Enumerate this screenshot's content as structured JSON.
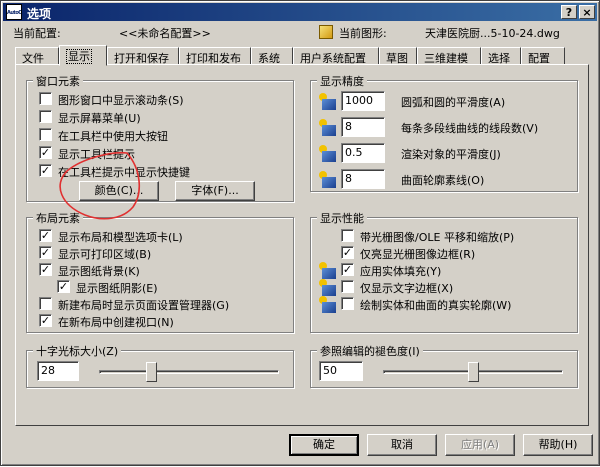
{
  "window": {
    "title": "选项",
    "app_icon": "AutoCAD",
    "help_label": "?",
    "close_label": "×"
  },
  "info": {
    "current_profile_label": "当前配置:",
    "current_profile_value": "<<未命名配置>>",
    "current_drawing_label": "当前图形:",
    "current_drawing_value": "天津医院厨...5-10-24.dwg"
  },
  "tabs": [
    "文件",
    "显示",
    "打开和保存",
    "打印和发布",
    "系统",
    "用户系统配置",
    "草图",
    "三维建模",
    "选择",
    "配置"
  ],
  "active_tab": "显示",
  "window_elements": {
    "title": "窗口元素",
    "items": [
      {
        "label": "图形窗口中显示滚动条(S)",
        "checked": false
      },
      {
        "label": "显示屏幕菜单(U)",
        "checked": false
      },
      {
        "label": "在工具栏中使用大按钮",
        "checked": false
      },
      {
        "label": "显示工具栏提示",
        "checked": true
      },
      {
        "label": "在工具栏提示中显示快捷键",
        "checked": true
      }
    ],
    "colors_button": "颜色(C)...",
    "fonts_button": "字体(F)..."
  },
  "layout_elements": {
    "title": "布局元素",
    "items": [
      {
        "label": "显示布局和模型选项卡(L)",
        "checked": true
      },
      {
        "label": "显示可打印区域(B)",
        "checked": true
      },
      {
        "label": "显示图纸背景(K)",
        "checked": true
      },
      {
        "label": "显示图纸阴影(E)",
        "checked": true
      },
      {
        "label": "新建布局时显示页面设置管理器(G)",
        "checked": false
      },
      {
        "label": "在新布局中创建视口(N)",
        "checked": true
      }
    ]
  },
  "crosshair": {
    "title": "十字光标大小(Z)",
    "value": "28",
    "level_percent": 28
  },
  "display_resolution": {
    "title": "显示精度",
    "items": [
      {
        "value": "1000",
        "label": "圆弧和圆的平滑度(A)"
      },
      {
        "value": "8",
        "label": "每条多段线曲线的线段数(V)"
      },
      {
        "value": "0.5",
        "label": "渲染对象的平滑度(J)"
      },
      {
        "value": "8",
        "label": "曲面轮廓素线(O)"
      }
    ]
  },
  "display_performance": {
    "title": "显示性能",
    "items": [
      {
        "label": "带光栅图像/OLE 平移和缩放(P)",
        "checked": false
      },
      {
        "label": "仅亮显光栅图像边框(R)",
        "checked": true
      },
      {
        "label": "应用实体填充(Y)",
        "checked": true
      },
      {
        "label": "仅显示文字边框(X)",
        "checked": false
      },
      {
        "label": "绘制实体和曲面的真实轮廓(W)",
        "checked": false
      }
    ]
  },
  "reference_fade": {
    "title": "参照编辑的褪色度(I)",
    "value": "50",
    "level_percent": 50
  },
  "footer": {
    "ok": "确定",
    "cancel": "取消",
    "apply": "应用(A)",
    "help": "帮助(H)"
  },
  "colors": {
    "face": "#d4d0c8",
    "title_start": "#0a246a",
    "title_end": "#3a6ea5",
    "annotation": "#e03030"
  }
}
